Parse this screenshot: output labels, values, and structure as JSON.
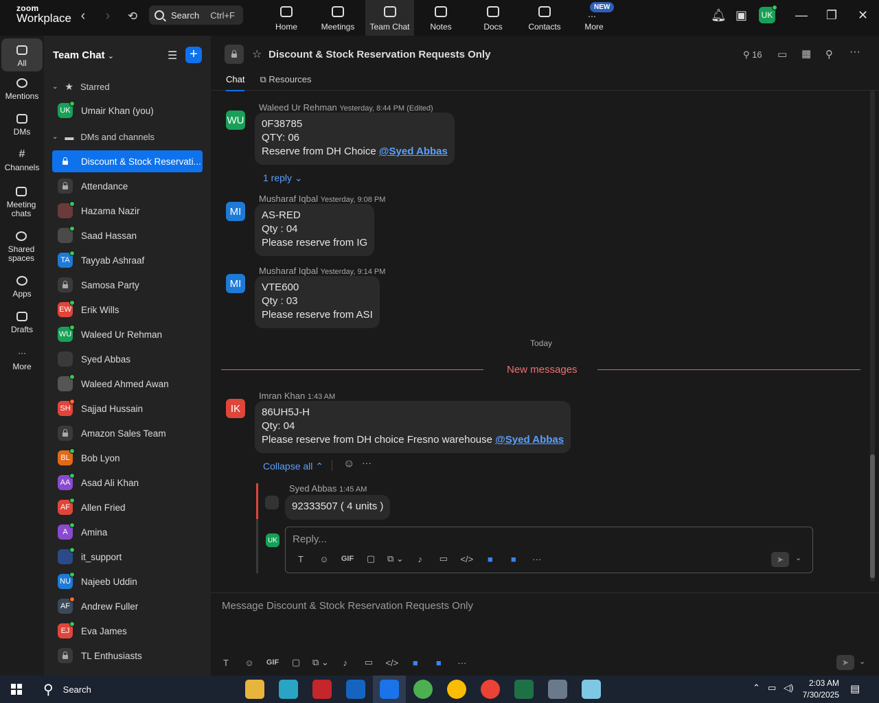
{
  "app": {
    "logo_top": "zoom",
    "logo_bottom": "Workplace"
  },
  "search": {
    "label": "Search",
    "shortcut": "Ctrl+F"
  },
  "nav_tabs": [
    {
      "label": "Home",
      "icon": "home-icon"
    },
    {
      "label": "Meetings",
      "icon": "video-icon"
    },
    {
      "label": "Team Chat",
      "icon": "chat-icon"
    },
    {
      "label": "Notes",
      "icon": "notes-icon"
    },
    {
      "label": "Docs",
      "icon": "docs-icon"
    },
    {
      "label": "Contacts",
      "icon": "contacts-icon"
    },
    {
      "label": "More",
      "icon": "more-icon"
    }
  ],
  "new_badge": "NEW",
  "user_avatar": "UK",
  "rail": [
    {
      "label": "All"
    },
    {
      "label": "Mentions"
    },
    {
      "label": "DMs"
    },
    {
      "label": "Channels"
    },
    {
      "label": "Meeting chats"
    },
    {
      "label": "Shared spaces"
    },
    {
      "label": "Apps"
    },
    {
      "label": "Drafts"
    },
    {
      "label": "More"
    }
  ],
  "sidebar": {
    "title": "Team Chat",
    "starred_label": "Starred",
    "dms_label": "DMs and channels",
    "starred": [
      {
        "initials": "UK",
        "name": "Umair Khan (you)",
        "color": "#18a058"
      }
    ],
    "items": [
      {
        "name": "Discount & Stock Reservati...",
        "lock": true
      },
      {
        "name": "Attendance",
        "lock": true
      },
      {
        "initials": "",
        "name": "Hazama Nazir",
        "color": "#6b3a3a"
      },
      {
        "initials": "",
        "name": "Saad Hassan",
        "color": "#4a4a4a"
      },
      {
        "initials": "TA",
        "name": "Tayyab Ashraaf",
        "color": "#1e7ad6"
      },
      {
        "name": "Samosa Party",
        "lock": true
      },
      {
        "initials": "EW",
        "name": "Erik Wills",
        "color": "#e0453a"
      },
      {
        "initials": "WU",
        "name": "Waleed Ur Rehman",
        "color": "#18a058"
      },
      {
        "initials": "",
        "name": "Syed Abbas",
        "color": "#3a3a3a"
      },
      {
        "initials": "",
        "name": "Waleed Ahmed Awan",
        "color": "#555"
      },
      {
        "initials": "SH",
        "name": "Sajjad Hussain",
        "color": "#e0453a"
      },
      {
        "name": "Amazon Sales Team",
        "lock": true
      },
      {
        "initials": "BL",
        "name": "Bob Lyon",
        "color": "#e06a1a"
      },
      {
        "initials": "AA",
        "name": "Asad Ali Khan",
        "color": "#8a4ad0"
      },
      {
        "initials": "AF",
        "name": "Allen Fried",
        "color": "#e0453a"
      },
      {
        "initials": "A",
        "name": "Amina",
        "color": "#8a4ad0"
      },
      {
        "initials": "",
        "name": "it_support",
        "color": "#2a4a8a"
      },
      {
        "initials": "NU",
        "name": "Najeeb Uddin",
        "color": "#1e7ad6"
      },
      {
        "initials": "AF",
        "name": "Andrew Fuller",
        "color": "#3a4a5a"
      },
      {
        "initials": "EJ",
        "name": "Eva James",
        "color": "#e0453a"
      },
      {
        "name": "TL Enthusiasts",
        "lock": true
      }
    ]
  },
  "channel": {
    "title": "Discount & Stock Reservation Requests Only",
    "member_count": "16",
    "tabs": [
      "Chat",
      "Resources"
    ]
  },
  "messages": [
    {
      "initials": "WU",
      "color": "#18a058",
      "sender": "Waleed Ur Rehman",
      "time": "Yesterday, 8:44 PM (Edited)",
      "lines": [
        "0F38785",
        "QTY: 06",
        "Reserve from DH Choice "
      ],
      "mention": "@Syed Abbas",
      "reply_link": "1 reply ⌄"
    },
    {
      "initials": "MI",
      "color": "#1e7ad6",
      "sender": "Musharaf Iqbal",
      "time": "Yesterday, 9:08 PM",
      "lines": [
        "AS-RED",
        "Qty : 04",
        "Please reserve from IG"
      ]
    },
    {
      "initials": "MI",
      "color": "#1e7ad6",
      "sender": "Musharaf Iqbal",
      "time": "Yesterday, 9:14 PM",
      "lines": [
        "VTE600",
        "Qty : 03",
        "Please reserve from ASI"
      ]
    },
    {
      "initials": "IK",
      "color": "#e0453a",
      "sender": "Imran Khan",
      "time": "1:43 AM",
      "lines": [
        "86UH5J-H",
        "Qty: 04",
        "Please reserve from DH choice Fresno warehouse "
      ],
      "mention": "@Syed Abbas"
    }
  ],
  "divider": {
    "today": "Today",
    "new_messages": "New messages"
  },
  "thread": {
    "collapse": "Collapse all ⌃",
    "reply_sender": "Syed Abbas",
    "reply_time": "1:45 AM",
    "reply_text": "92333507 ( 4 units )",
    "reply_placeholder": "Reply...",
    "my_initials": "UK"
  },
  "composer": {
    "placeholder": "Message Discount & Stock Reservation Requests Only"
  },
  "toolbar": {
    "gif": "GIF"
  },
  "taskbar": {
    "search": "Search",
    "time": "2:03 AM",
    "date": "7/30/2025"
  }
}
